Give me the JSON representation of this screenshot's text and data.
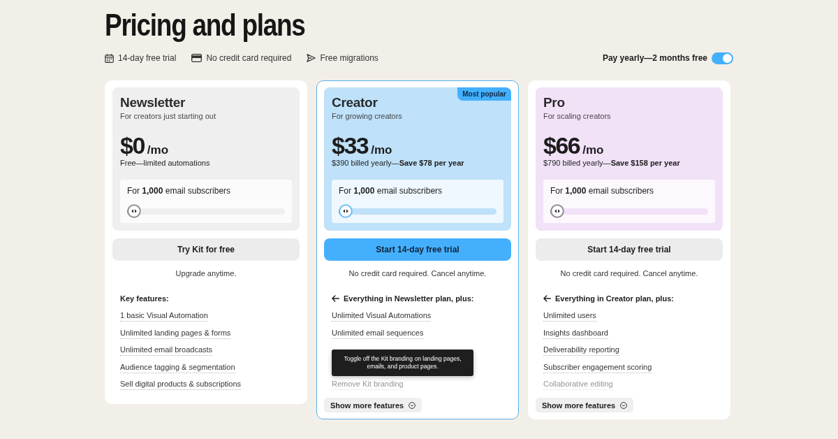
{
  "page": {
    "title": "Pricing and plans"
  },
  "perks": [
    {
      "kind": "calendar",
      "text": "14-day free trial"
    },
    {
      "kind": "card",
      "text": "No credit card required"
    },
    {
      "kind": "send",
      "text": "Free migrations"
    }
  ],
  "billing_toggle": {
    "label": "Pay yearly—2 months free",
    "on": true
  },
  "plans": [
    {
      "name": "Newsletter",
      "tagline": "For creators just starting out",
      "color": "#efefef",
      "highlighted": false,
      "price": "$0",
      "period": "/mo",
      "billing": "Free—limited automations",
      "slider": {
        "label": "For **1,000** email subscribers",
        "level": 0
      },
      "cta": "Try Kit for free",
      "note": "Upgrade anytime.",
      "features_heading": {
        "kind": "plain",
        "text": "Key features:"
      },
      "features": [
        {
          "kind": "feature",
          "text": "1 basic Visual Automation",
          "faded": false
        },
        {
          "kind": "feature",
          "text": "Unlimited landing pages & forms",
          "faded": false
        },
        {
          "kind": "feature",
          "text": "Unlimited email broadcasts",
          "faded": false
        },
        {
          "kind": "feature",
          "text": "Audience tagging & segmentation",
          "faded": false
        },
        {
          "kind": "feature",
          "text": "Sell digital products & subscriptions",
          "faded": false
        }
      ]
    },
    {
      "name": "Creator",
      "tagline": "For growing creators",
      "color": "#bfe1f9",
      "highlighted": true,
      "badge": "Most popular",
      "price": "$33",
      "period": "/mo",
      "billing": "$390 billed yearly—**Save $78 per year**",
      "slider": {
        "label": "For **1,000** email subscribers",
        "level": 0
      },
      "cta": "Start 14-day free trial",
      "note": "No credit card required. Cancel anytime.",
      "features_heading": {
        "kind": "inherit",
        "text": "Everything in Newsletter plan, plus:"
      },
      "features": [
        {
          "kind": "feature",
          "text": "Unlimited Visual Automations",
          "faded": false
        },
        {
          "kind": "feature",
          "text": "Unlimited email sequences",
          "faded": false
        },
        {
          "kind": "tooltip",
          "text": "Toggle off the Kit branding on landing pages, emails, and product pages."
        },
        {
          "kind": "feature",
          "text": "Remove Kit branding",
          "faded": true
        }
      ],
      "more_button": "Show more features"
    },
    {
      "name": "Pro",
      "tagline": "For scaling creators",
      "color": "#f1e2f8",
      "highlighted": false,
      "price": "$66",
      "period": "/mo",
      "billing": "$790 billed yearly—**Save $158 per year**",
      "slider": {
        "label": "For **1,000** email subscribers",
        "level": 0
      },
      "cta": "Start 14-day free trial",
      "note": "No credit card required. Cancel anytime.",
      "features_heading": {
        "kind": "inherit",
        "text": "Everything in Creator plan, plus:"
      },
      "features": [
        {
          "kind": "feature",
          "text": "Unlimited users",
          "faded": false
        },
        {
          "kind": "feature",
          "text": "Insights dashboard",
          "faded": false
        },
        {
          "kind": "feature",
          "text": "Deliverability reporting",
          "faded": false
        },
        {
          "kind": "feature",
          "text": "Subscriber engagement scoring",
          "faded": false
        },
        {
          "kind": "feature",
          "text": "Collaborative editing",
          "faded": true
        }
      ],
      "more_button": "Show more features"
    }
  ]
}
